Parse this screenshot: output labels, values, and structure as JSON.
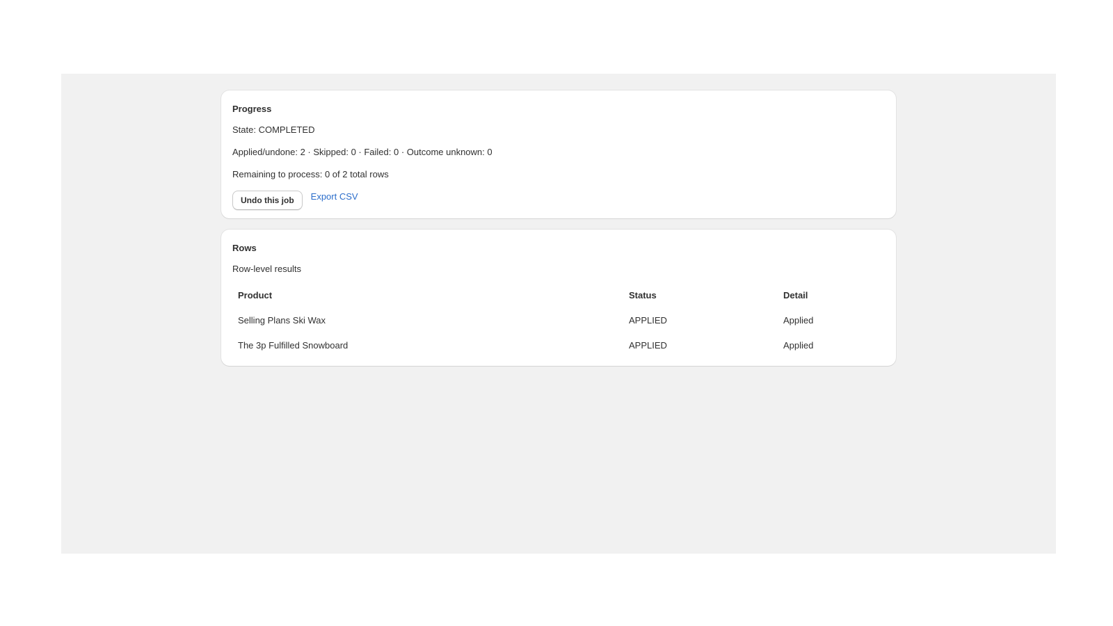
{
  "progress": {
    "title": "Progress",
    "state": "State: COMPLETED",
    "counts": "Applied/undone: 2 · Skipped: 0 · Failed: 0 · Outcome unknown: 0",
    "remaining": "Remaining to process: 0 of 2 total rows",
    "undo_label": "Undo this job",
    "export_label": "Export CSV"
  },
  "rows": {
    "title": "Rows",
    "subtitle": "Row-level results",
    "columns": [
      "Product",
      "Status",
      "Detail"
    ],
    "items": [
      {
        "product": "Selling Plans Ski Wax",
        "status": "APPLIED",
        "detail": "Applied"
      },
      {
        "product": "The 3p Fulfilled Snowboard",
        "status": "APPLIED",
        "detail": "Applied"
      }
    ]
  },
  "colors": {
    "link": "#2c6ecb",
    "background": "#f1f1f1",
    "card": "#ffffff"
  }
}
